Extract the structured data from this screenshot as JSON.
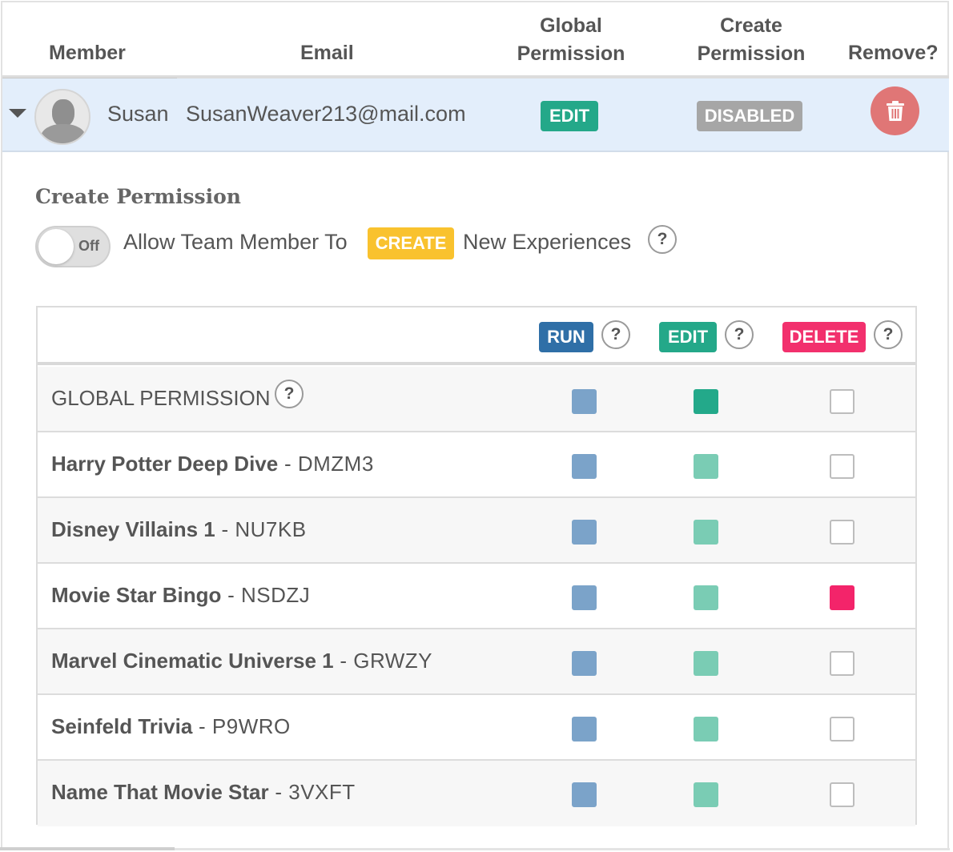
{
  "header": {
    "member": "Member",
    "email": "Email",
    "global_permission_line1": "Global",
    "global_permission_line2": "Permission",
    "create_permission_line1": "Create",
    "create_permission_line2": "Permission",
    "remove": "Remove?"
  },
  "member": {
    "name": "Susan",
    "email": "SusanWeaver213@mail.com",
    "global_permission": "EDIT",
    "create_permission": "DISABLED"
  },
  "create_permission": {
    "title": "Create Permission",
    "toggle_state": "Off",
    "text_before": "Allow Team Member To",
    "create_badge": "CREATE",
    "text_after": "New Experiences",
    "help": "?"
  },
  "permissions_table": {
    "columns": {
      "run": "RUN",
      "edit": "EDIT",
      "delete": "DELETE",
      "help": "?"
    },
    "global_row": {
      "label": "GLOBAL PERMISSION",
      "help": "?",
      "run": true,
      "edit": true,
      "delete": false
    },
    "rows": [
      {
        "title": "Harry Potter Deep Dive",
        "code": " - DMZM3",
        "run": true,
        "edit": true,
        "delete": false
      },
      {
        "title": "Disney Villains 1",
        "code": " - NU7KB",
        "run": true,
        "edit": true,
        "delete": false
      },
      {
        "title": "Movie Star Bingo",
        "code": " - NSDZJ",
        "run": true,
        "edit": true,
        "delete": true
      },
      {
        "title": "Marvel Cinematic Universe 1",
        "code": " - GRWZY",
        "run": true,
        "edit": true,
        "delete": false
      },
      {
        "title": "Seinfeld Trivia",
        "code": " - P9WRO",
        "run": true,
        "edit": true,
        "delete": false
      },
      {
        "title": "Name That Movie Star",
        "code": " - 3VXFT",
        "run": true,
        "edit": true,
        "delete": false
      }
    ]
  },
  "icons": {
    "expand": "caret-down-icon",
    "avatar": "user-silhouette-icon",
    "remove": "trash-icon",
    "help": "question-icon"
  },
  "colors": {
    "run": "#2f6fa7",
    "edit": "#24a889",
    "delete": "#f2306d",
    "create": "#f9c22e",
    "disabled": "#a6a6a6",
    "remove": "#e07676",
    "row_highlight": "#e3eefb"
  }
}
